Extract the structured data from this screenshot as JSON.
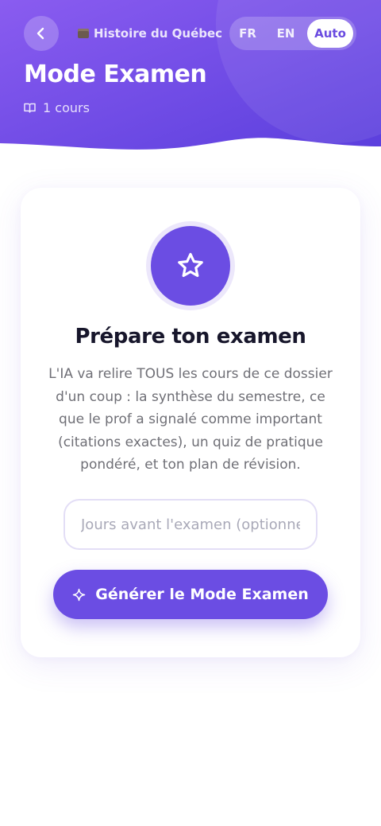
{
  "header": {
    "folder_name": "Histoire du Québec",
    "title": "Mode Examen",
    "course_count": "1 cours",
    "languages": {
      "fr": "FR",
      "en": "EN",
      "auto": "Auto"
    },
    "selected_language": "Auto"
  },
  "card": {
    "title": "Prépare ton examen",
    "description": "L'IA va relire TOUS les cours de ce dossier d'un coup : la synthèse du semestre, ce que le prof a signalé comme important (citations exactes), un quiz de pratique pondéré, et ton plan de révision.",
    "days_input": {
      "value": "",
      "placeholder": "Jours avant l'examen (optionnel)"
    },
    "generate_label": "Générer le Mode Examen"
  },
  "colors": {
    "accent": "#6b4de3",
    "header_gradient_start": "#8a5cf0",
    "header_gradient_end": "#5b3fdd",
    "title_text": "#17162b",
    "body_text": "#6f6f76"
  },
  "icons": {
    "back": "chevron-left-icon",
    "folder": "folder-emoji-icon",
    "book": "book-icon",
    "star": "star-icon",
    "sparkle": "sparkle-icon"
  }
}
